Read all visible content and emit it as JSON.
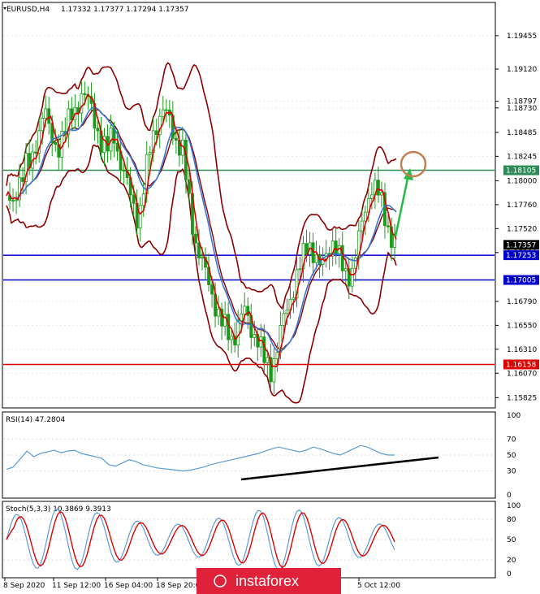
{
  "header": {
    "symbol": "EURUSD,H4",
    "ohlc": "1.17332 1.17377 1.17294 1.17357"
  },
  "colors": {
    "candle": "#1a9a1a",
    "bollinger": "#8b0000",
    "ma_fast": "#e00000",
    "ma_slow": "#3a78d8",
    "green_level": "#2e8b57",
    "blue_level": "#0000cc",
    "red_level": "#dd0000",
    "arrow": "#22bb44",
    "circle": "#c08050",
    "rsi": "#5b9bd5",
    "stoch_main": "#5b9bd5",
    "stoch_signal": "#e00000"
  },
  "chart_data": [
    {
      "type": "candlestick",
      "panel": "price",
      "ylim": [
        1.1573,
        1.1978
      ],
      "y_ticks": [
        "1.19455",
        "1.19120",
        "1.18797",
        "1.18730",
        "1.18485",
        "1.18245",
        "1.18000",
        "1.17760",
        "1.17520",
        "1.17280",
        "1.16790",
        "1.16550",
        "1.16310",
        "1.16070",
        "1.15825"
      ],
      "x_ticks": [
        "8 Sep 2020",
        "11 Sep 12:00",
        "16 Sep 04:00",
        "18 Sep 20:00",
        "5 Oct 12:00"
      ],
      "close_series": [
        1.1785,
        1.177,
        1.18,
        1.182,
        1.1812,
        1.1845,
        1.188,
        1.184,
        1.183,
        1.185,
        1.186,
        1.187,
        1.189,
        1.188,
        1.186,
        1.184,
        1.183,
        1.185,
        1.182,
        1.18,
        1.178,
        1.176,
        1.18,
        1.184,
        1.186,
        1.187,
        1.186,
        1.184,
        1.183,
        1.178,
        1.174,
        1.172,
        1.17,
        1.168,
        1.166,
        1.165,
        1.164,
        1.166,
        1.167,
        1.165,
        1.164,
        1.162,
        1.161,
        1.163,
        1.166,
        1.168,
        1.17,
        1.172,
        1.174,
        1.1725,
        1.171,
        1.173,
        1.174,
        1.172,
        1.1705,
        1.171,
        1.174,
        1.177,
        1.1795,
        1.179,
        1.177,
        1.1745,
        1.1735
      ],
      "price_labels": [
        {
          "value": 1.18105,
          "text": "1.18105",
          "color": "#2e8b57"
        },
        {
          "value": 1.17357,
          "text": "1.17357",
          "color": "#000000"
        },
        {
          "value": 1.17253,
          "text": "1.17253",
          "color": "#0000cc"
        },
        {
          "value": 1.17005,
          "text": "1.17005",
          "color": "#0000cc"
        },
        {
          "value": 1.16158,
          "text": "1.16158",
          "color": "#dd0000"
        }
      ],
      "horizontal_levels": [
        {
          "value": 1.18105,
          "color": "#2e8b57"
        },
        {
          "value": 1.17253,
          "color": "#0000cc"
        },
        {
          "value": 1.17005,
          "color": "#0000cc"
        },
        {
          "value": 1.16158,
          "color": "#dd0000"
        }
      ]
    },
    {
      "type": "line",
      "panel": "rsi",
      "name": "RSI(14) 47.2804",
      "ylim": [
        0,
        100
      ],
      "y_ticks": [
        "100",
        "70",
        "50",
        "30",
        "0"
      ],
      "values": [
        32,
        35,
        45,
        55,
        48,
        52,
        54,
        56,
        53,
        55,
        56,
        52,
        50,
        48,
        46,
        38,
        36,
        40,
        44,
        42,
        38,
        36,
        34,
        33,
        32,
        31,
        30,
        31,
        33,
        35,
        38,
        40,
        42,
        44,
        46,
        48,
        50,
        52,
        55,
        58,
        60,
        58,
        56,
        54,
        56,
        60,
        58,
        55,
        52,
        50,
        54,
        58,
        62,
        60,
        56,
        52,
        50,
        50
      ]
    },
    {
      "type": "line",
      "panel": "stoch",
      "name": "Stoch(5,3,3) 10.3869 9.3913",
      "ylim": [
        0,
        100
      ],
      "y_ticks": [
        "100",
        "80",
        "50",
        "20",
        "0"
      ]
    }
  ],
  "watermark": "instaforex"
}
